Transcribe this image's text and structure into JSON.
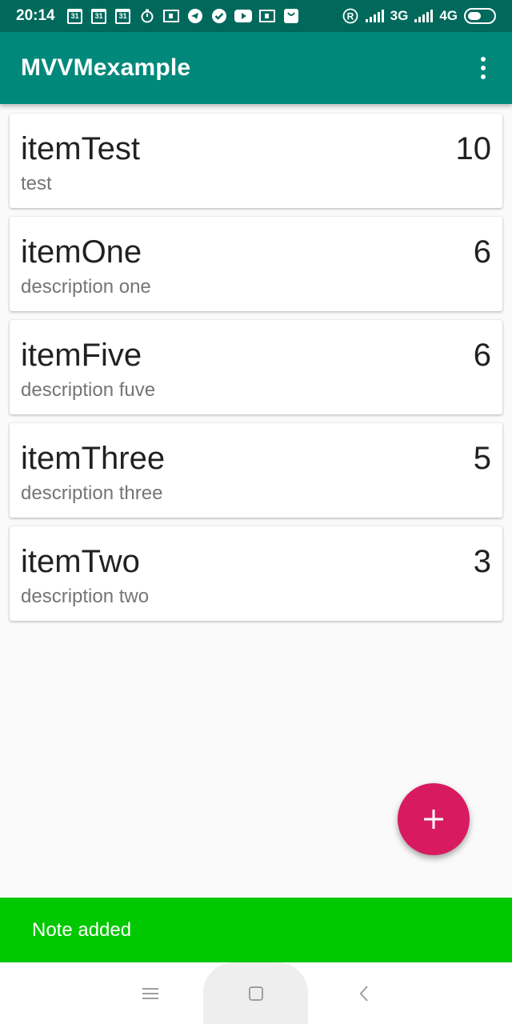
{
  "status_bar": {
    "time": "20:14",
    "calendar_day": "31",
    "network_1": "3G",
    "network_2": "4G",
    "registered_mark": "R"
  },
  "app_bar": {
    "title": "MVVMexample"
  },
  "items": [
    {
      "title": "itemTest",
      "description": "test",
      "priority": "10"
    },
    {
      "title": "itemOne",
      "description": "description one",
      "priority": "6"
    },
    {
      "title": "itemFive",
      "description": "description fuve",
      "priority": "6"
    },
    {
      "title": "itemThree",
      "description": "description three",
      "priority": "5"
    },
    {
      "title": "itemTwo",
      "description": "description two",
      "priority": "3"
    }
  ],
  "fab": {
    "icon": "plus-icon"
  },
  "snackbar": {
    "message": "Note added"
  },
  "colors": {
    "status_bar": "#00695c",
    "app_bar": "#00897b",
    "fab": "#d81b60",
    "snackbar": "#00c800"
  }
}
